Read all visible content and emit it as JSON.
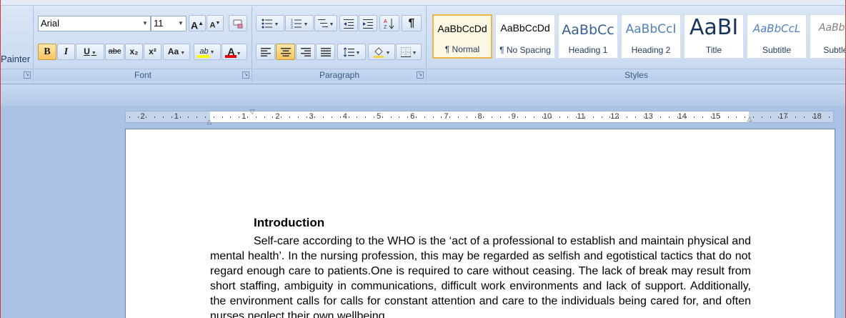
{
  "ribbon": {
    "clipboard": {
      "format_painter_label": "Painter"
    },
    "font": {
      "group_label": "Font",
      "font_name": "Arial",
      "font_size": "11",
      "grow_font": "A",
      "shrink_font": "A",
      "bold": "B",
      "italic": "I",
      "underline": "U",
      "strikethrough": "abc",
      "subscript": "x₂",
      "superscript": "x²",
      "change_case": "Aa",
      "highlight": "ab",
      "font_color": "A",
      "highlight_color": "#ffff00",
      "font_color_value": "#e00000"
    },
    "paragraph": {
      "group_label": "Paragraph",
      "show_marks": "¶"
    },
    "styles": {
      "group_label": "Styles",
      "items": [
        {
          "sample": "AaBbCcDd",
          "name": "¶ Normal",
          "selected": true
        },
        {
          "sample": "AaBbCcDd",
          "name": "¶ No Spacing",
          "selected": false
        },
        {
          "sample": "AaBbCc",
          "name": "Heading 1",
          "selected": false
        },
        {
          "sample": "AaBbCcI",
          "name": "Heading 2",
          "selected": false
        },
        {
          "sample": "AaBI",
          "name": "Title",
          "selected": false
        },
        {
          "sample": "AaBbCcL",
          "name": "Subtitle",
          "selected": false
        },
        {
          "sample": "AaBbCcI",
          "name": "Subtle E",
          "selected": false
        }
      ]
    }
  },
  "ruler": {
    "left_numbers": [
      "2",
      "1"
    ],
    "right_numbers": [
      "1",
      "2",
      "3",
      "4",
      "5",
      "6",
      "7",
      "8",
      "9",
      "10",
      "11",
      "12",
      "13",
      "14",
      "15",
      "17",
      "18"
    ]
  },
  "document": {
    "heading": "Introduction",
    "paragraph": "Self-care according to the WHO is the ‘act of a professional to establish and maintain physical and mental health’. In the nursing profession, this may be regarded as selfish and egotistical tactics that do not regard enough care to patients.One is required to care without ceasing. The lack of break may result from short staffing, ambiguity in communications, difficult work environments and lack of support. Additionally, the environment calls for calls for constant attention and care to the individuals being cared for, and often nurses neglect their own wellbeing."
  }
}
